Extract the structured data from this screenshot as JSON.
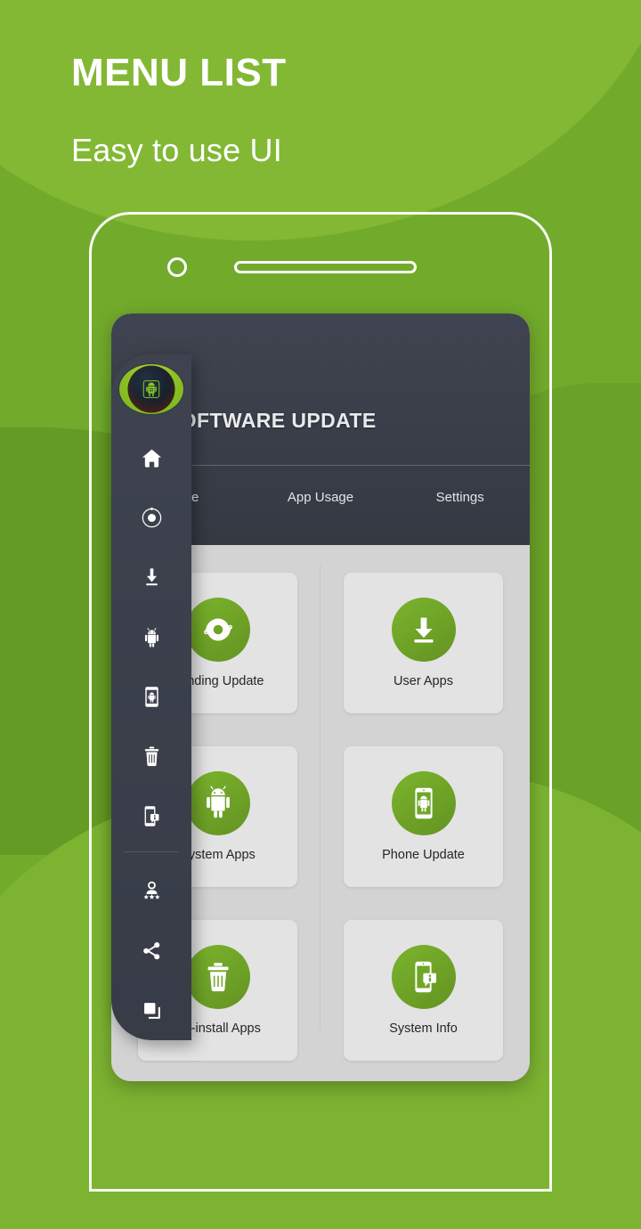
{
  "page": {
    "headline": "MENU LIST",
    "subheadline": "Easy to use UI",
    "accent_green": "#7bb42c",
    "background_green": "#72ab2c",
    "drawer_dark": "#3e434f"
  },
  "app": {
    "title": "SOFTWARE UPDATE",
    "logo_icon": "android-update-logo-icon",
    "tabs": [
      {
        "label": "Home",
        "icon": "home-tab-icon"
      },
      {
        "label": "App Usage",
        "icon": "app-usage-tab-icon"
      },
      {
        "label": "Settings",
        "icon": "settings-tab-icon"
      }
    ]
  },
  "drawer": {
    "items": [
      {
        "label": "Home",
        "icon": "home-icon"
      },
      {
        "label": "Pending Update",
        "icon": "pending-update-icon"
      },
      {
        "label": "User Apps",
        "icon": "download-icon"
      },
      {
        "label": "System Apps",
        "icon": "android-robot-icon"
      },
      {
        "label": "Phone Update",
        "icon": "phone-android-icon"
      },
      {
        "label": "Un-install Apps",
        "icon": "trash-icon"
      },
      {
        "label": "System Info",
        "icon": "phone-info-icon"
      }
    ],
    "secondary_items": [
      {
        "label": "Rate Us",
        "icon": "rate-star-person-icon"
      },
      {
        "label": "Share",
        "icon": "share-icon"
      },
      {
        "label": "More Apps",
        "icon": "more-apps-icon"
      }
    ]
  },
  "menu_grid": {
    "tiles": [
      {
        "label": "Pending Update",
        "icon": "pending-update-icon"
      },
      {
        "label": "User Apps",
        "icon": "download-icon"
      },
      {
        "label": "System Apps",
        "icon": "android-robot-icon"
      },
      {
        "label": "Phone Update",
        "icon": "phone-android-icon"
      },
      {
        "label": "Un-install Apps",
        "icon": "trash-icon"
      },
      {
        "label": "System Info",
        "icon": "phone-info-icon"
      }
    ]
  },
  "device": {
    "camera": "phone-camera-icon",
    "speaker": "phone-speaker-icon"
  }
}
